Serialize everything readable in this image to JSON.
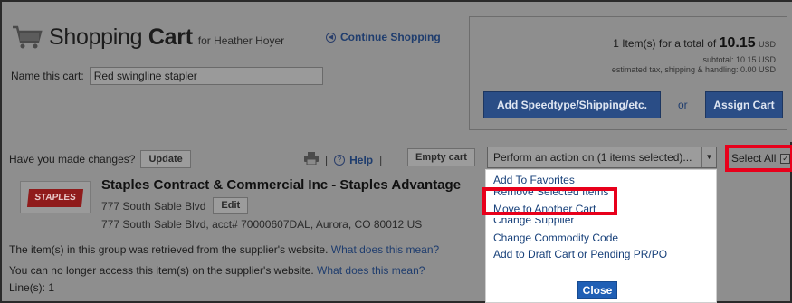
{
  "header": {
    "title_light": "Shopping",
    "title_bold": "Cart",
    "title_for": "for Heather Hoyer",
    "continue_label": "Continue Shopping",
    "name_label": "Name this cart:",
    "name_value": "Red swingline stapler"
  },
  "summary": {
    "items_text": "1 Item(s)  for a total of",
    "total": "10.15",
    "currency": "USD",
    "subtotal_line": "subtotal:  10.15 USD",
    "estimated_line": "estimated tax, shipping & handling:   0.00 USD",
    "speedtype_label": "Add Speedtype/Shipping/etc.",
    "or_label": "or",
    "assign_label": "Assign Cart"
  },
  "toolbar": {
    "changes_text": "Have you made changes?",
    "update_label": "Update",
    "separator": "|",
    "help_label": "Help",
    "empty_label": "Empty cart",
    "action_select_value": "Perform an action on (1 items selected)...",
    "select_all_label": "Select All"
  },
  "supplier": {
    "logo_text": "STAPLES",
    "name": "Staples Contract & Commercial Inc - Staples Advantage",
    "address_short": "777 South Sable Blvd",
    "edit_label": "Edit",
    "address_full": "777 South Sable Blvd, acct# 70000607DAL, Aurora, CO 80012 US",
    "info1_text": "The item(s) in this group was retrieved from the supplier's website.",
    "info1_link": "What does this mean?",
    "info2_text": "You can no longer access this item(s) on the supplier's website.",
    "info2_link": "What does this mean?",
    "lines_text": "Line(s): 1"
  },
  "menu": {
    "items": [
      "Add To Favorites",
      "Remove Selected Items",
      "Move to Another Cart",
      "Change Supplier",
      "Change Commodity Code",
      "Add to Draft Cart or Pending PR/PO"
    ],
    "close_label": "Close"
  },
  "colors": {
    "highlight": "#e8001b",
    "link": "#17407a",
    "close_button": "#1f5fb5",
    "dim_overlay": "#8e8e8e"
  }
}
